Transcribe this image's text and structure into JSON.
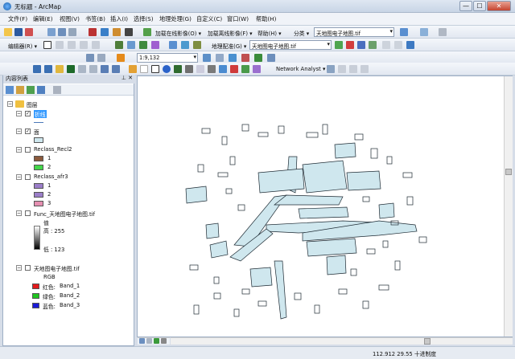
{
  "window": {
    "title": "无标题 - ArcMap",
    "minimize_label": "—",
    "maximize_label": "☐",
    "close_label": "✕"
  },
  "menu": [
    "文件(F)",
    "编辑(E)",
    "视图(V)",
    "书签(B)",
    "插入(I)",
    "选择(S)",
    "地理处理(G)",
    "自定义(C)",
    "窗口(W)",
    "帮助(H)"
  ],
  "toolbar1": {
    "online_imagery": "加载在线影像(O) ▾",
    "offline_imagery": "加载离线影像(F) ▾",
    "help": "帮助(H) ▾",
    "classify": "分类 ▾",
    "layer_combo": "天地图电子地图.tif"
  },
  "toolbar2": {
    "editor": "编辑器(R) ▾",
    "georef": "地理配准(G) ▾",
    "georef_combo": "天地图电子地图.tif"
  },
  "toolbar3": {
    "scale": "1:9,132",
    "network_analyst": "Network Analyst ▾"
  },
  "toc": {
    "title": "内容列表",
    "pin": "⊥ ✕",
    "layers_root": "图层",
    "layers": [
      {
        "name": "折线",
        "checked": true
      },
      {
        "name": "面",
        "checked": true
      },
      {
        "name": "Reclass_Recl2",
        "checked": false,
        "classes": [
          "1",
          "2"
        ]
      },
      {
        "name": "Reclass_afr3",
        "checked": false,
        "classes": [
          "1",
          "2",
          "3"
        ]
      },
      {
        "name": "Func_天地图电子地图.tif",
        "checked": false,
        "legend_title": "值",
        "high": "高 : 255",
        "low": "低 : 123"
      },
      {
        "name": "天地图电子地图.tif",
        "checked": false,
        "legend_title": "RGB",
        "bands": [
          {
            "label": "红色:",
            "band": "Band_1"
          },
          {
            "label": "绿色:",
            "band": "Band_2"
          },
          {
            "label": "蓝色:",
            "band": "Band_3"
          }
        ]
      }
    ]
  },
  "status": {
    "coords": "112.912  29.55 十进制度"
  },
  "colors": {
    "polygon_fill": "#cfe7ee",
    "polygon_stroke": "#1d2a33",
    "class_brown": "#8b5a3c",
    "class_green": "#43d64a",
    "class_purple": "#9b7ec9",
    "class_pink": "#e58fb1",
    "band_red": "#e31a1c",
    "band_green": "#1fc41f",
    "band_blue": "#1a1ad6"
  }
}
